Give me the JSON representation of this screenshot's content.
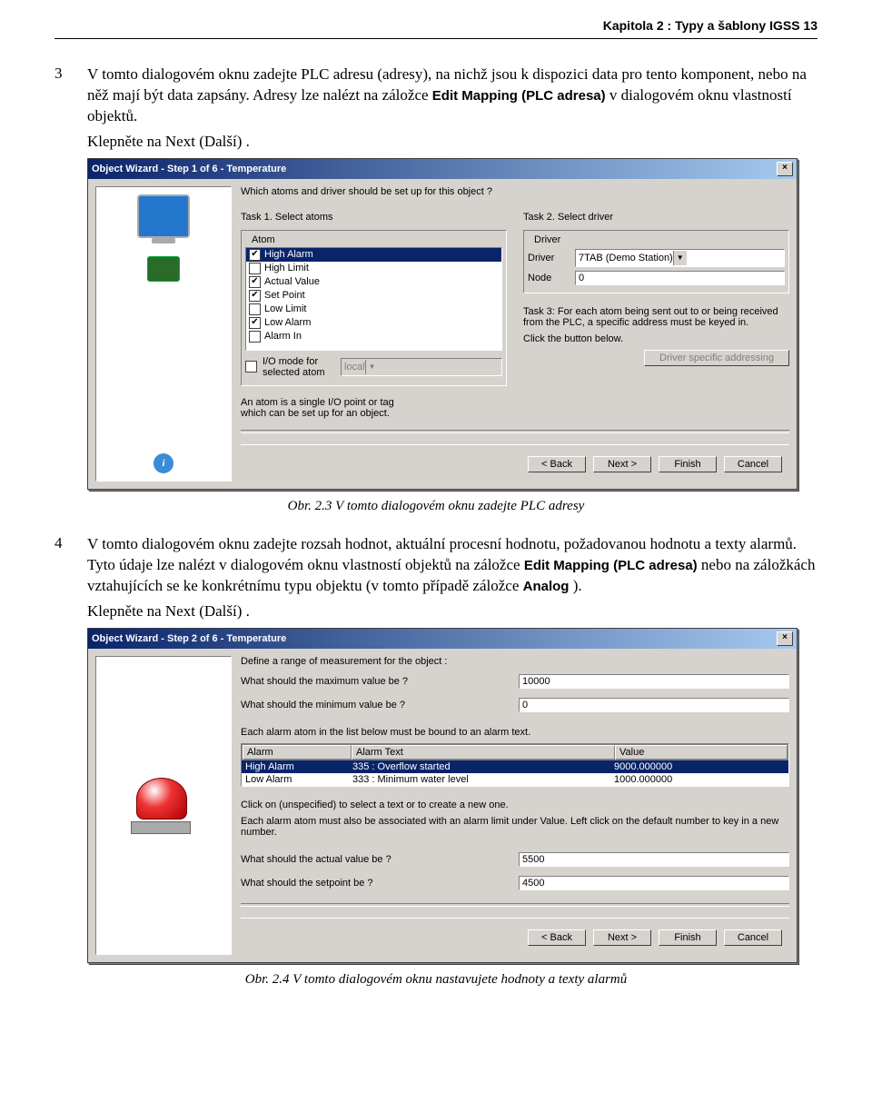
{
  "header": "Kapitola 2 : Typy a šablony IGSS   13",
  "step3": {
    "no": "3",
    "text_a": "V tomto dialogovém oknu zadejte PLC adresu (adresy), na nichž jsou k dispozici data pro tento komponent, nebo na něž mají být data zapsány. Adresy lze nalézt na záložce ",
    "bold1": "Edit Mapping (PLC adresa)",
    "text_b": " v dialogovém oknu vlastností objektů.",
    "click_a": "Klepněte na ",
    "click_b": "Next (Další)",
    "click_c": "."
  },
  "dlg1": {
    "title": "Object Wizard - Step 1 of 6 - Temperature",
    "prompt": "Which atoms and driver should be set up for this object ?",
    "task1": "Task 1. Select atoms",
    "task2": "Task 2. Select driver",
    "group_atom": "Atom",
    "group_driver": "Driver",
    "atoms": [
      {
        "label": "High Alarm",
        "checked": true,
        "sel": true
      },
      {
        "label": "High Limit",
        "checked": false
      },
      {
        "label": "Actual Value",
        "checked": true
      },
      {
        "label": "Set Point",
        "checked": true
      },
      {
        "label": "Low Limit",
        "checked": false
      },
      {
        "label": "Low Alarm",
        "checked": true
      },
      {
        "label": "Alarm In",
        "checked": false
      }
    ],
    "driver_label": "Driver",
    "driver_value": "7TAB (Demo Station)",
    "node_label": "Node",
    "node_value": "0",
    "task3": "Task 3: For each atom being sent out to or being received from the PLC, a specific address must be keyed in.",
    "click_below": "Click the button below.",
    "dsa_button": "Driver specific addressing",
    "io_mode": "I/O mode for selected atom",
    "io_value": "local",
    "hint": "An atom is a single I/O point or tag which can be set up for an object.",
    "btn_back": "< Back",
    "btn_next": "Next >",
    "btn_finish": "Finish",
    "btn_cancel": "Cancel"
  },
  "caption1": "Obr. 2.3  V tomto dialogovém oknu zadejte PLC adresy",
  "step4": {
    "no": "4",
    "text_a": "V tomto dialogovém oknu zadejte rozsah hodnot, aktuální procesní hodnotu, požadovanou hodnotu a texty alarmů. Tyto údaje lze nalézt v dialogovém oknu vlastností objektů na záložce ",
    "bold1": "Edit Mapping (PLC adresa)",
    "text_b": " nebo na záložkách vztahujících se ke konkrétnímu typu objektu (v tomto případě záložce ",
    "bold2": "Analog",
    "text_c": ").",
    "click_a": "Klepněte na ",
    "click_b": "Next (Další)",
    "click_c": "."
  },
  "dlg2": {
    "title": "Object Wizard - Step 2 of 6 - Temperature",
    "line1": "Define a range of measurement for the object :",
    "max_q": "What should the maximum value be ?",
    "max_v": "10000",
    "min_q": "What should the minimum value be ?",
    "min_v": "0",
    "line2": "Each alarm atom in the list below must be bound to an alarm text.",
    "th_alarm": "Alarm",
    "th_text": "Alarm Text",
    "th_value": "Value",
    "rows": [
      {
        "alarm": "High Alarm",
        "text": "335 : Overflow started",
        "value": "9000.000000",
        "sel": true
      },
      {
        "alarm": "Low Alarm",
        "text": "333 : Minimum water level",
        "value": "1000.000000"
      }
    ],
    "line3": "Click on (unspecified) to select a text or to create a new one.",
    "line4": "Each alarm atom must also be associated with an alarm limit under Value. Left click on the default number to key in a new number.",
    "actual_q": "What should the actual value be ?",
    "actual_v": "5500",
    "sp_q": "What should the setpoint be ?",
    "sp_v": "4500",
    "btn_back": "< Back",
    "btn_next": "Next >",
    "btn_finish": "Finish",
    "btn_cancel": "Cancel"
  },
  "caption2": "Obr. 2.4  V tomto dialogovém oknu nastavujete hodnoty a texty alarmů"
}
